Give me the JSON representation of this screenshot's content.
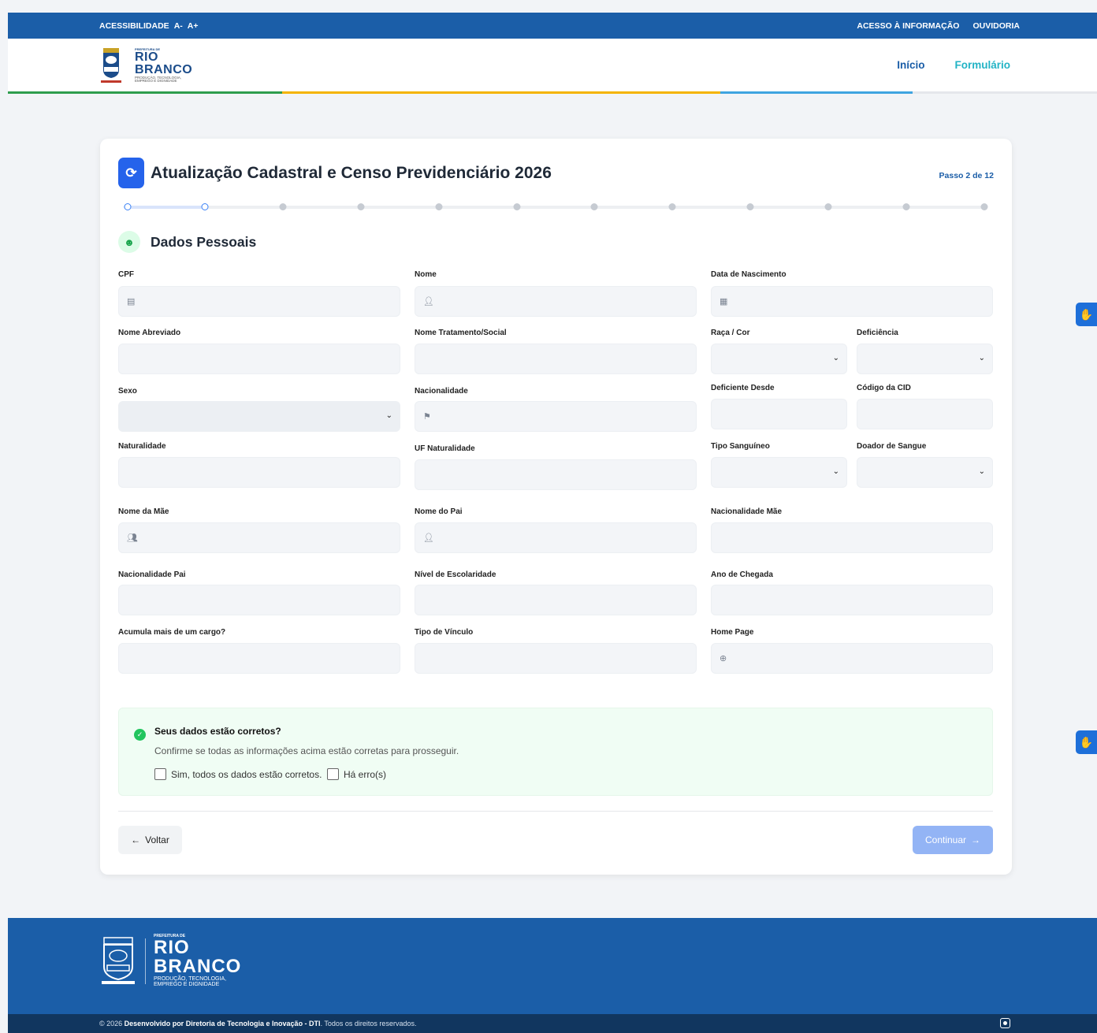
{
  "topbar": {
    "accessibility": "ACESSIBILIDADE",
    "font_decrease": "A-",
    "font_increase": "A+",
    "info_access": "ACESSO À INFORMAÇÃO",
    "ombudsman": "OUVIDORIA"
  },
  "logo": {
    "prefix": "PREFEITURA DE",
    "line1": "RIO",
    "line2": "BRANCO",
    "tagline1": "PRODUÇÃO, TECNOLOGIA,",
    "tagline2": "EMPREGO E DIGNIDADE"
  },
  "nav": {
    "home": "Início",
    "form": "Formulário"
  },
  "colors": {
    "primary": "#1b5ea8",
    "accent": "#22b3c5",
    "stripe": [
      "#2e9d4d",
      "#f4b400",
      "#3ea4e0",
      "#e5e7eb"
    ]
  },
  "card": {
    "title": "Atualização Cadastral e Censo Previdenciário 2026",
    "step": "Passo 2 de 12",
    "total_steps": 12,
    "current_step": 2,
    "section_title": "Dados Pessoais",
    "icons": {
      "title": "sync-icon",
      "section": "user-circle-icon"
    }
  },
  "form": {
    "cpf": "CPF",
    "nome": "Nome",
    "data_nascimento": "Data de Nascimento",
    "nome_abreviado": "Nome Abreviado",
    "nome_social": "Nome Tratamento/Social",
    "raca_cor": "Raça / Cor",
    "deficiencia": "Deficiência",
    "sexo": "Sexo",
    "nacionalidade": "Nacionalidade",
    "deficiente_desde": "Deficiente Desde",
    "codigo_cid": "Código da CID",
    "naturalidade": "Naturalidade",
    "uf_naturalidade": "UF Naturalidade",
    "tipo_sanguineo": "Tipo Sanguíneo",
    "doador_sangue": "Doador de Sangue",
    "nome_mae": "Nome da Mãe",
    "nome_pai": "Nome do Pai",
    "nacionalidade_mae": "Nacionalidade Mãe",
    "nacionalidade_pai": "Nacionalidade Pai",
    "escolaridade": "Nível de Escolaridade",
    "ano_chegada": "Ano de Chegada",
    "acumula_cargo": "Acumula mais de um cargo?",
    "tipo_vinculo": "Tipo de Vínculo",
    "home_page": "Home Page"
  },
  "confirm": {
    "question": "Seus dados estão corretos?",
    "description": "Confirme se todas as informações acima estão corretas para prosseguir.",
    "yes_label": "Sim, todos os dados estão corretos.",
    "error_label": "Há erro(s)"
  },
  "buttons": {
    "back": "Voltar",
    "next": "Continuar"
  },
  "footer": {
    "year": "© 2026",
    "developer": "Desenvolvido por Diretoria de Tecnologia e Inovação - DTI",
    "rights": ". Todos os direitos reservados."
  }
}
